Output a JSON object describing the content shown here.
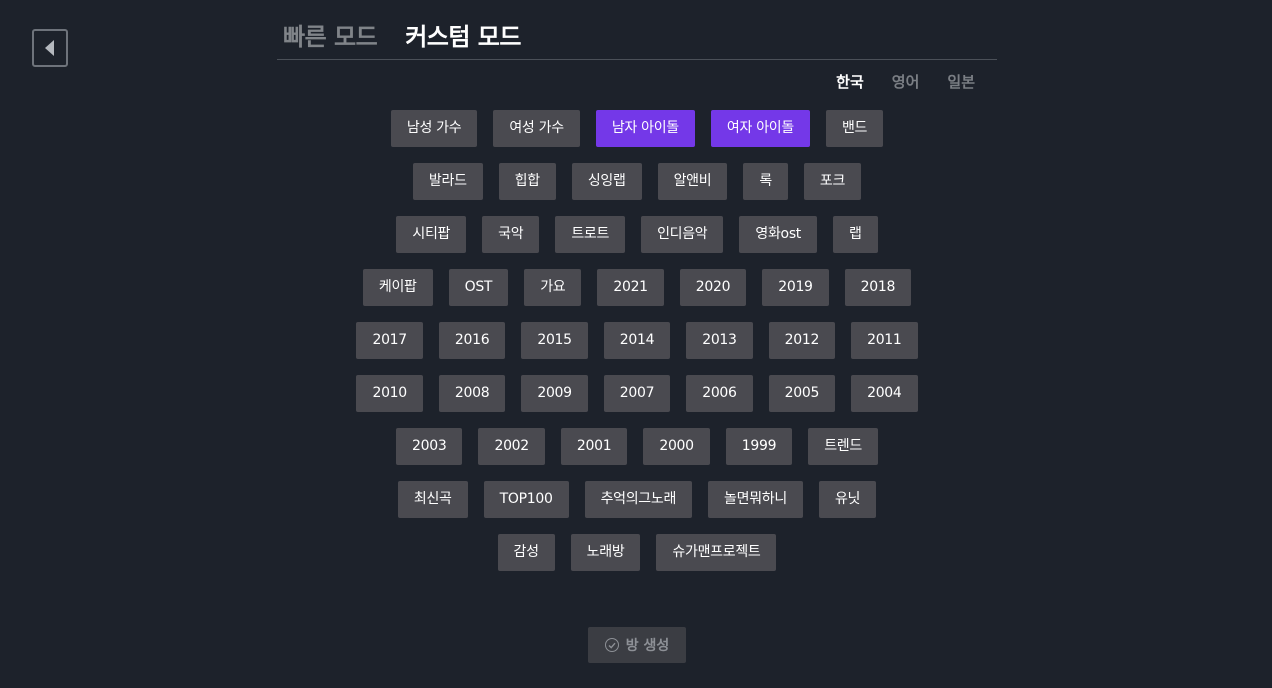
{
  "mode_tabs": {
    "quick": "빠른 모드",
    "custom": "커스텀 모드"
  },
  "language_tabs": [
    "한국",
    "영어",
    "일본"
  ],
  "categories": [
    [
      {
        "label": "남성 가수",
        "selected": false
      },
      {
        "label": "여성 가수",
        "selected": false
      },
      {
        "label": "남자 아이돌",
        "selected": true
      },
      {
        "label": "여자 아이돌",
        "selected": true
      },
      {
        "label": "밴드",
        "selected": false
      }
    ],
    [
      {
        "label": "발라드",
        "selected": false
      },
      {
        "label": "힙합",
        "selected": false
      },
      {
        "label": "싱잉랩",
        "selected": false
      },
      {
        "label": "알앤비",
        "selected": false
      },
      {
        "label": "록",
        "selected": false
      },
      {
        "label": "포크",
        "selected": false
      }
    ],
    [
      {
        "label": "시티팝",
        "selected": false
      },
      {
        "label": "국악",
        "selected": false
      },
      {
        "label": "트로트",
        "selected": false
      },
      {
        "label": "인디음악",
        "selected": false
      },
      {
        "label": "영화ost",
        "selected": false
      },
      {
        "label": "랩",
        "selected": false
      }
    ],
    [
      {
        "label": "케이팝",
        "selected": false
      },
      {
        "label": "OST",
        "selected": false
      },
      {
        "label": "가요",
        "selected": false
      },
      {
        "label": "2021",
        "selected": false
      },
      {
        "label": "2020",
        "selected": false
      },
      {
        "label": "2019",
        "selected": false
      },
      {
        "label": "2018",
        "selected": false
      }
    ],
    [
      {
        "label": "2017",
        "selected": false
      },
      {
        "label": "2016",
        "selected": false
      },
      {
        "label": "2015",
        "selected": false
      },
      {
        "label": "2014",
        "selected": false
      },
      {
        "label": "2013",
        "selected": false
      },
      {
        "label": "2012",
        "selected": false
      },
      {
        "label": "2011",
        "selected": false
      }
    ],
    [
      {
        "label": "2010",
        "selected": false
      },
      {
        "label": "2008",
        "selected": false
      },
      {
        "label": "2009",
        "selected": false
      },
      {
        "label": "2007",
        "selected": false
      },
      {
        "label": "2006",
        "selected": false
      },
      {
        "label": "2005",
        "selected": false
      },
      {
        "label": "2004",
        "selected": false
      }
    ],
    [
      {
        "label": "2003",
        "selected": false
      },
      {
        "label": "2002",
        "selected": false
      },
      {
        "label": "2001",
        "selected": false
      },
      {
        "label": "2000",
        "selected": false
      },
      {
        "label": "1999",
        "selected": false
      },
      {
        "label": "트렌드",
        "selected": false
      }
    ],
    [
      {
        "label": "최신곡",
        "selected": false
      },
      {
        "label": "TOP100",
        "selected": false
      },
      {
        "label": "추억의그노래",
        "selected": false
      },
      {
        "label": "놀면뭐하니",
        "selected": false
      },
      {
        "label": "유닛",
        "selected": false
      }
    ],
    [
      {
        "label": "감성",
        "selected": false
      },
      {
        "label": "노래방",
        "selected": false
      },
      {
        "label": "슈가맨프로젝트",
        "selected": false
      }
    ]
  ],
  "create_button": {
    "label": "방 생성",
    "icon": "check-circle-icon"
  },
  "colors": {
    "background": "#1d222b",
    "chip": "#4a4a50",
    "chip_selected": "#7438e8"
  }
}
